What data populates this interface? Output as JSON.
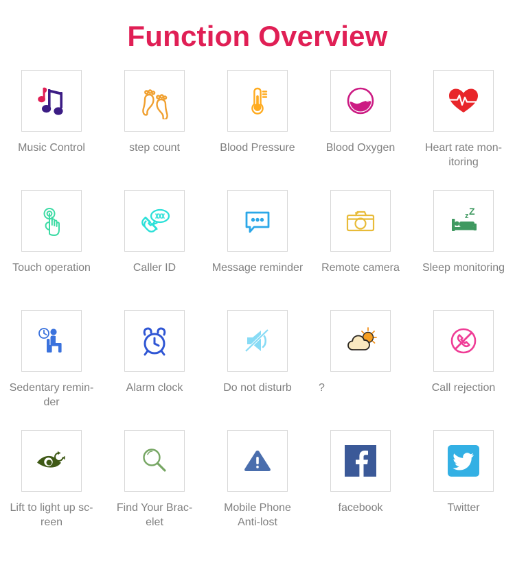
{
  "page": {
    "title": "Function Overview",
    "title_color": "#e01f55",
    "background": "#ffffff",
    "label_color": "#808080",
    "tile_border_color": "#d8d8d8"
  },
  "functions": [
    {
      "label": "Music Control",
      "icon": "music-note-icon",
      "color": "#3b1c84"
    },
    {
      "label": "step count",
      "icon": "footprints-icon",
      "color": "#f0a030"
    },
    {
      "label": "Blood Pressure",
      "icon": "thermometer-icon",
      "color": "#ffab1f"
    },
    {
      "label": "Blood Oxygen",
      "icon": "blood-oxygen-icon",
      "color": "#cc1b83"
    },
    {
      "label": "Heart rate mon-\nitoring",
      "icon": "heart-pulse-icon",
      "color": "#e8262a"
    },
    {
      "label": "Touch operation",
      "icon": "touch-hand-icon",
      "color": "#3ddba5"
    },
    {
      "label": "Caller ID",
      "icon": "caller-id-icon",
      "color": "#2ce0d8"
    },
    {
      "label": "Message reminder",
      "icon": "message-bubble-icon",
      "color": "#2ba7e8"
    },
    {
      "label": "Remote camera",
      "icon": "camera-icon",
      "color": "#e8bb38"
    },
    {
      "label": "Sleep monitoring",
      "icon": "sleep-bed-icon",
      "color": "#3f9960"
    },
    {
      "label": "Sedentary remin-\nder",
      "icon": "sedentary-person-icon",
      "color": "#3a72dd"
    },
    {
      "label": "Alarm clock",
      "icon": "alarm-clock-icon",
      "color": "#2f56d4"
    },
    {
      "label": "Do not disturb",
      "icon": "mute-speaker-icon",
      "color": "#87dbf5"
    },
    {
      "label": "?",
      "icon": "weather-sun-cloud-icon",
      "color": "#f2921d"
    },
    {
      "label": "Call rejection",
      "icon": "call-reject-icon",
      "color": "#ef3d96"
    },
    {
      "label": "Lift to light up sc-\nreen",
      "icon": "eye-refresh-icon",
      "color": "#3f5916"
    },
    {
      "label": "Find Your Brac-\nelet",
      "icon": "magnifier-icon",
      "color": "#76a663"
    },
    {
      "label": "Mobile Phone\nAnti-lost",
      "icon": "warning-triangle-icon",
      "color": "#4a6ead"
    },
    {
      "label": "facebook",
      "icon": "facebook-icon",
      "color": "#3b5998"
    },
    {
      "label": "Twitter",
      "icon": "twitter-icon",
      "color": "#33b0e4"
    }
  ]
}
